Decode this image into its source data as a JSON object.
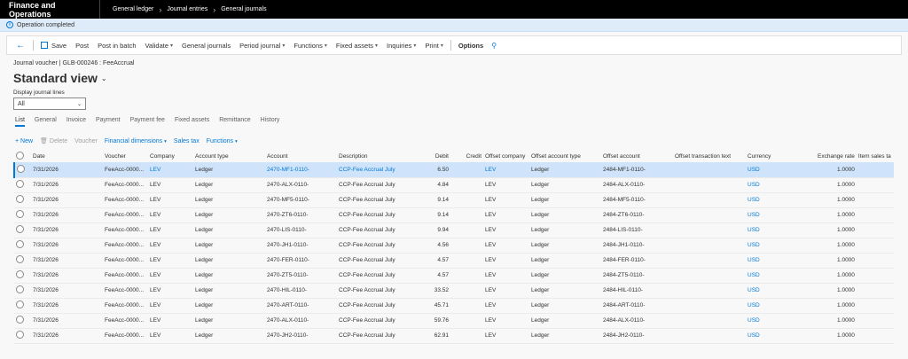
{
  "app": {
    "title": "Finance and Operations"
  },
  "breadcrumb": [
    "General ledger",
    "Journal entries",
    "General journals"
  ],
  "message": "Operation completed",
  "actions": {
    "save": "Save",
    "post": "Post",
    "post_in_batch": "Post in batch",
    "validate": "Validate",
    "general_journals": "General journals",
    "period_journal": "Period journal",
    "functions": "Functions",
    "fixed_assets": "Fixed assets",
    "inquiries": "Inquiries",
    "print": "Print",
    "options": "Options"
  },
  "header": {
    "subtitle": "Journal voucher  |  GLB-000246 : FeeAccrual",
    "view": "Standard view",
    "display_label": "Display journal lines",
    "display_value": "All"
  },
  "tabs": [
    "List",
    "General",
    "Invoice",
    "Payment",
    "Payment fee",
    "Fixed assets",
    "Remittance",
    "History"
  ],
  "grid_toolbar": {
    "new": "+ New",
    "delete": "Delete",
    "voucher": "Voucher",
    "financial_dimensions": "Financial dimensions",
    "sales_tax": "Sales tax",
    "functions": "Functions"
  },
  "columns": [
    "Date",
    "Voucher",
    "Company",
    "Account type",
    "Account",
    "Description",
    "Debit",
    "Credit",
    "Offset company",
    "Offset account type",
    "Offset account",
    "Offset transaction text",
    "Currency",
    "Exchange rate",
    "Item sales ta"
  ],
  "rows": [
    [
      "7/31/2026",
      "FeeAcc-0000...",
      "LEV",
      "Ledger",
      "2470-MF1-0110-",
      "CCP-Fee Accrual July",
      "6.50",
      "",
      "LEV",
      "Ledger",
      "2484-MF1-0110-",
      "",
      "USD",
      "1.0000"
    ],
    [
      "7/31/2026",
      "FeeAcc-0000...",
      "LEV",
      "Ledger",
      "2470-ALX-0110-",
      "CCP-Fee Accrual July",
      "4.84",
      "",
      "LEV",
      "Ledger",
      "2484-ALX-0110-",
      "",
      "USD",
      "1.0000"
    ],
    [
      "7/31/2026",
      "FeeAcc-0000...",
      "LEV",
      "Ledger",
      "2470-MF5-0110-",
      "CCP-Fee Accrual July",
      "9.14",
      "",
      "LEV",
      "Ledger",
      "2484-MF5-0110-",
      "",
      "USD",
      "1.0000"
    ],
    [
      "7/31/2026",
      "FeeAcc-0000...",
      "LEV",
      "Ledger",
      "2470-ZT6-0110-",
      "CCP-Fee Accrual July",
      "9.14",
      "",
      "LEV",
      "Ledger",
      "2484-ZT6-0110-",
      "",
      "USD",
      "1.0000"
    ],
    [
      "7/31/2026",
      "FeeAcc-0000...",
      "LEV",
      "Ledger",
      "2470-LIS-0110-",
      "CCP-Fee Accrual July",
      "9.94",
      "",
      "LEV",
      "Ledger",
      "2484-LIS-0110-",
      "",
      "USD",
      "1.0000"
    ],
    [
      "7/31/2026",
      "FeeAcc-0000...",
      "LEV",
      "Ledger",
      "2470-JH1-0110-",
      "CCP-Fee Accrual July",
      "4.56",
      "",
      "LEV",
      "Ledger",
      "2484-JH1-0110-",
      "",
      "USD",
      "1.0000"
    ],
    [
      "7/31/2026",
      "FeeAcc-0000...",
      "LEV",
      "Ledger",
      "2470-FER-0110-",
      "CCP-Fee Accrual July",
      "4.57",
      "",
      "LEV",
      "Ledger",
      "2484-FER-0110-",
      "",
      "USD",
      "1.0000"
    ],
    [
      "7/31/2026",
      "FeeAcc-0000...",
      "LEV",
      "Ledger",
      "2470-ZT5-0110-",
      "CCP-Fee Accrual July",
      "4.57",
      "",
      "LEV",
      "Ledger",
      "2484-ZT5-0110-",
      "",
      "USD",
      "1.0000"
    ],
    [
      "7/31/2026",
      "FeeAcc-0000...",
      "LEV",
      "Ledger",
      "2470-HIL-0110-",
      "CCP-Fee Accrual July",
      "33.52",
      "",
      "LEV",
      "Ledger",
      "2484-HIL-0110-",
      "",
      "USD",
      "1.0000"
    ],
    [
      "7/31/2026",
      "FeeAcc-0000...",
      "LEV",
      "Ledger",
      "2470-ART-0110-",
      "CCP-Fee Accrual July",
      "45.71",
      "",
      "LEV",
      "Ledger",
      "2484-ART-0110-",
      "",
      "USD",
      "1.0000"
    ],
    [
      "7/31/2026",
      "FeeAcc-0000...",
      "LEV",
      "Ledger",
      "2470-ALX-0110-",
      "CCP-Fee Accrual July",
      "59.76",
      "",
      "LEV",
      "Ledger",
      "2484-ALX-0110-",
      "",
      "USD",
      "1.0000"
    ],
    [
      "7/31/2026",
      "FeeAcc-0000...",
      "LEV",
      "Ledger",
      "2470-JH2-0110-",
      "CCP-Fee Accrual July",
      "62.91",
      "",
      "LEV",
      "Ledger",
      "2484-JH2-0110-",
      "",
      "USD",
      "1.0000"
    ]
  ],
  "colors": {
    "accent": "#0078d4",
    "selected_row": "#cfe4fa",
    "message_bar": "#deecf9"
  }
}
